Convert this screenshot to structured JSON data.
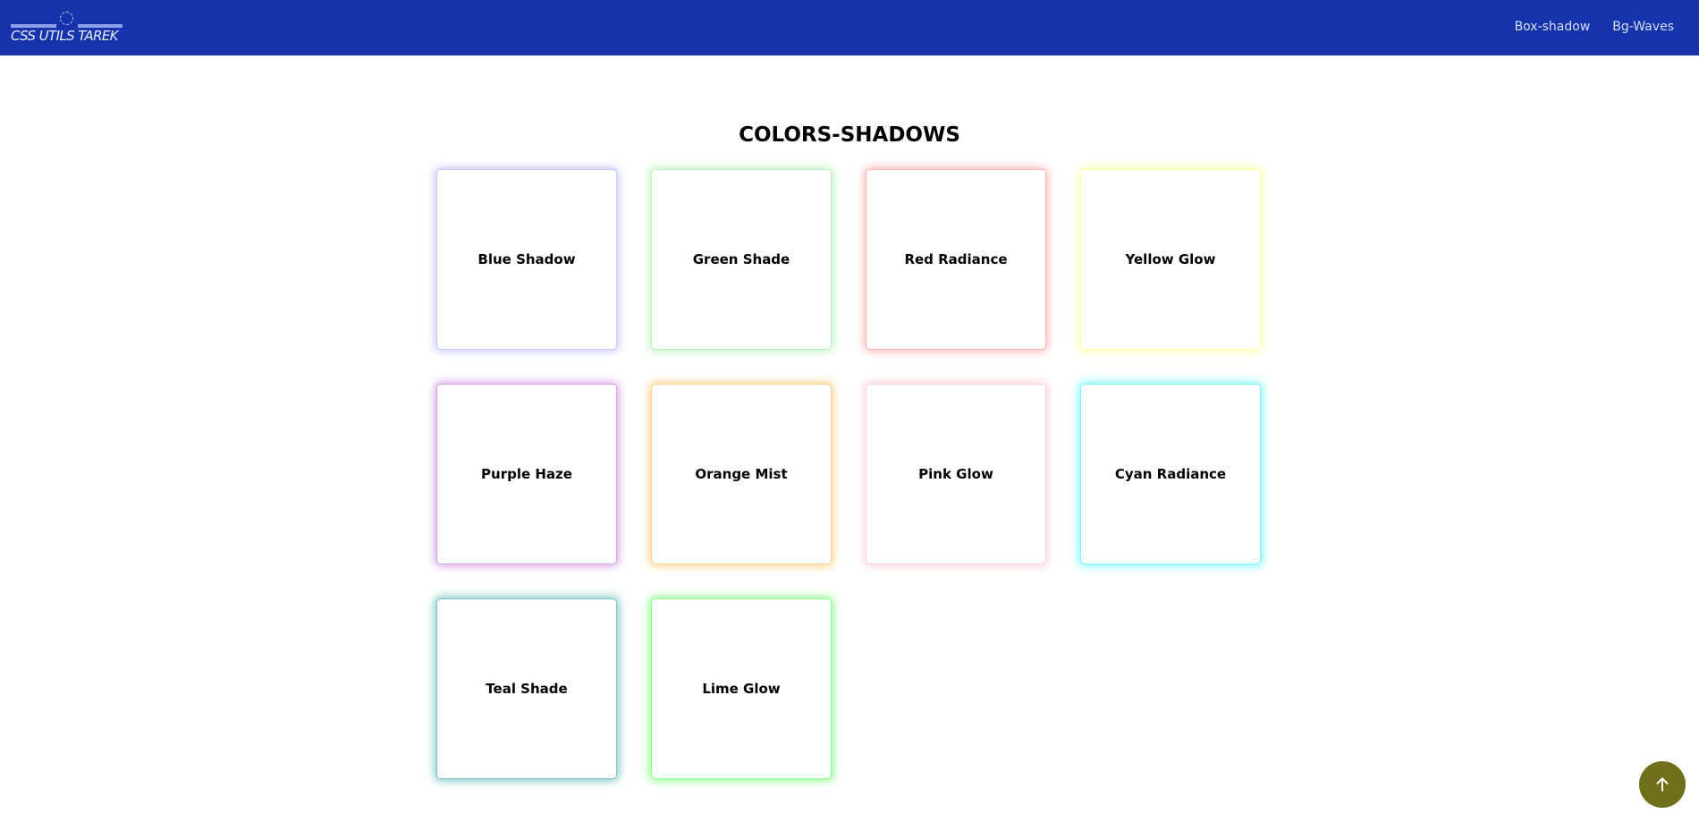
{
  "header": {
    "logo_text": "CSS UTILS TAREK",
    "nav": [
      {
        "label": "Box-shadow"
      },
      {
        "label": "Bg-Waves"
      }
    ]
  },
  "main": {
    "title": "COLORS-SHADOWS",
    "cards": [
      {
        "label": "Blue Shadow",
        "color": "#c8c8ff"
      },
      {
        "label": "Green Shade",
        "color": "#bff3bf"
      },
      {
        "label": "Red Radiance",
        "color": "#ffb8b8"
      },
      {
        "label": "Yellow Glow",
        "color": "#ffffb0"
      },
      {
        "label": "Purple Haze",
        "color": "#d9a3e6"
      },
      {
        "label": "Orange Mist",
        "color": "#ffd28a"
      },
      {
        "label": "Pink Glow",
        "color": "#ffd3dc"
      },
      {
        "label": "Cyan Radiance",
        "color": "#7ef7ff"
      },
      {
        "label": "Teal Shade",
        "color": "#7fc5c5"
      },
      {
        "label": "Lime Glow",
        "color": "#8cff8c"
      }
    ]
  },
  "scroll_top": {
    "icon": "arrow-up-icon",
    "color": "#6f6f1c"
  }
}
